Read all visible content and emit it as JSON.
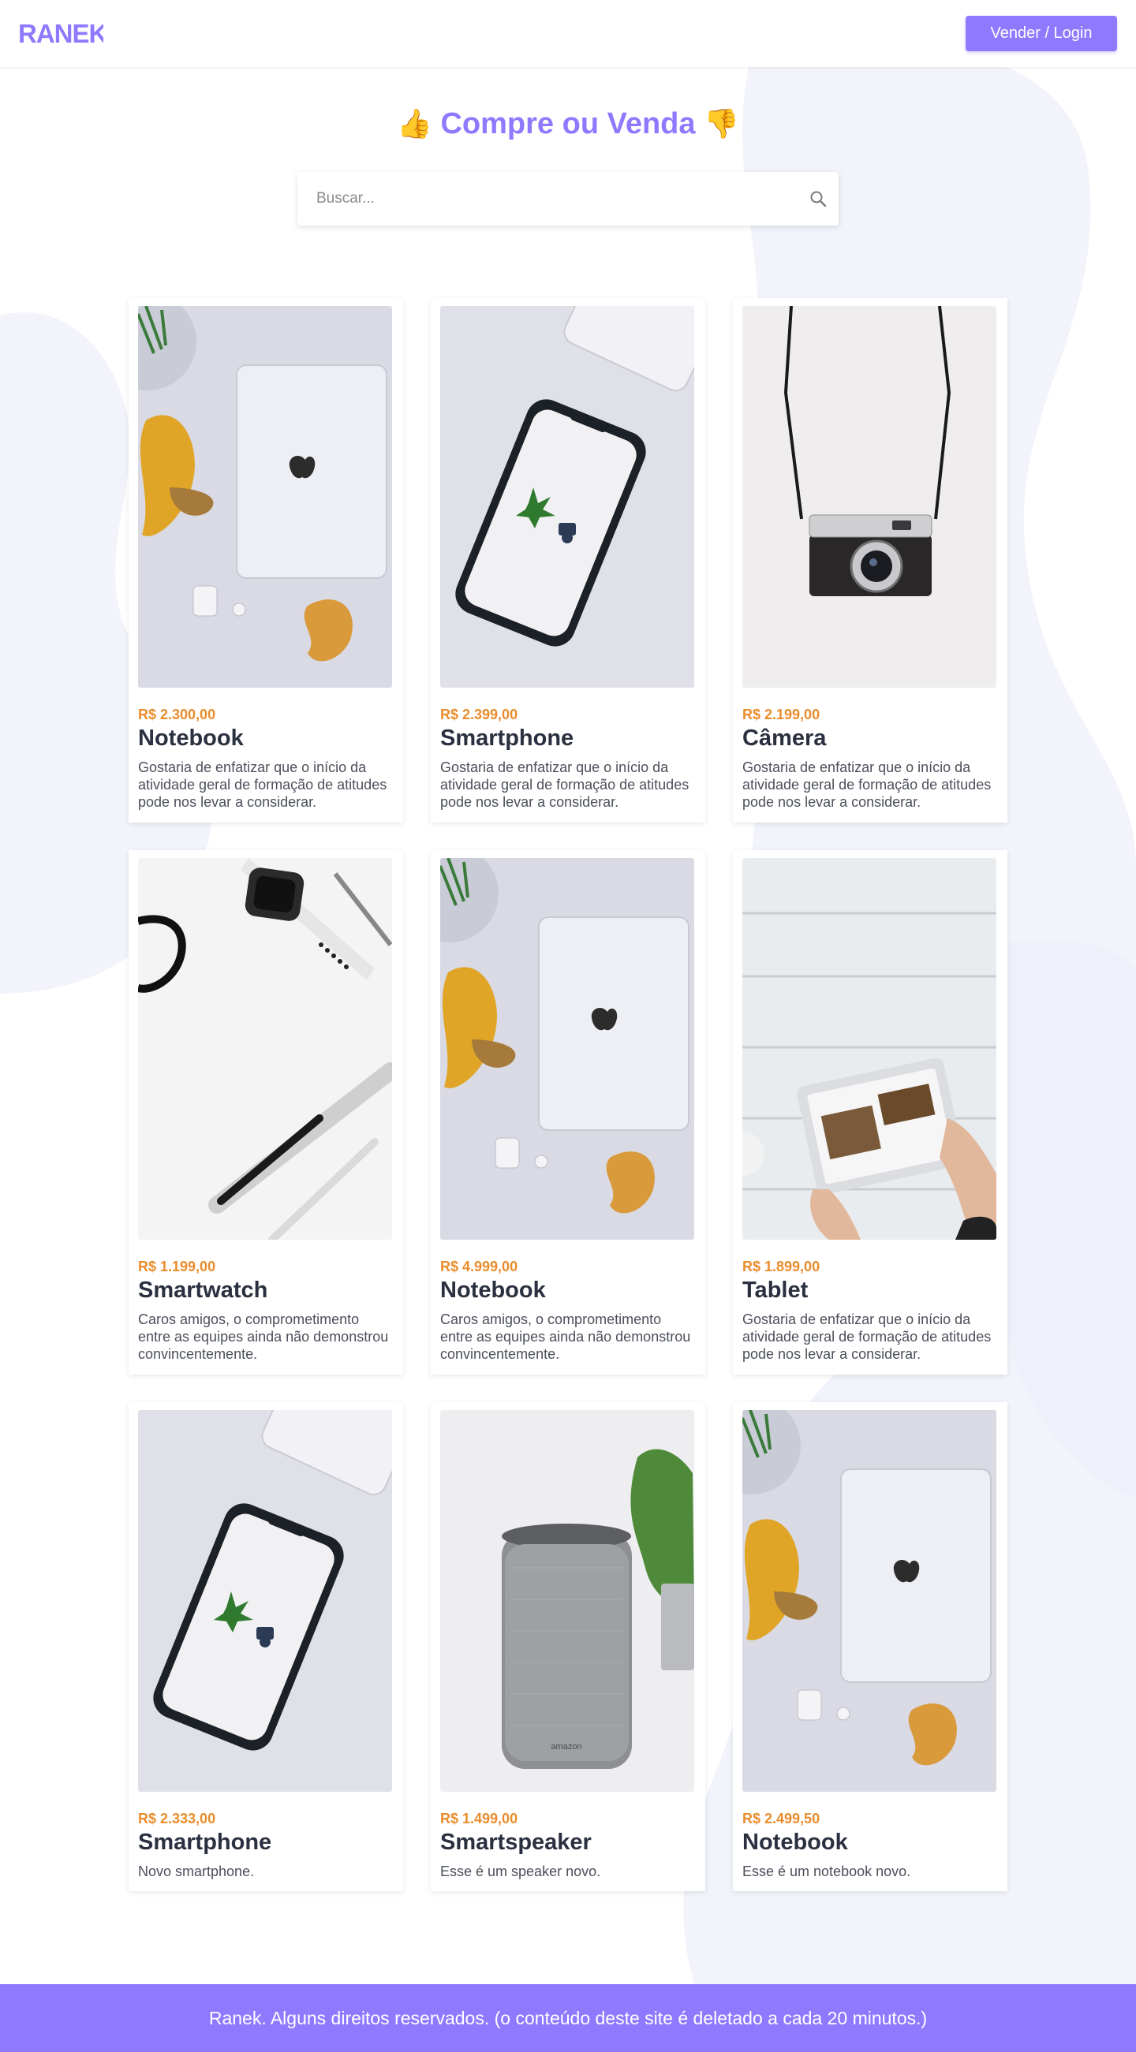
{
  "header": {
    "logo_text": "RANEK",
    "login_label": "Vender / Login"
  },
  "hero": {
    "title": "Compre ou Venda",
    "icon_left": "thumbs-up-icon",
    "icon_right": "thumbs-down-icon",
    "emoji_left": "👍",
    "emoji_right": "👎"
  },
  "search": {
    "placeholder": "Buscar...",
    "value": "",
    "icon": "search-icon"
  },
  "products": [
    {
      "price": "R$ 2.300,00",
      "name": "Notebook",
      "desc": "Gostaria de enfatizar que o início da atividade geral de formação de atitudes pode nos levar a considerar.",
      "image": "notebook-photo"
    },
    {
      "price": "R$ 2.399,00",
      "name": "Smartphone",
      "desc": "Gostaria de enfatizar que o início da atividade geral de formação de atitudes pode nos levar a considerar.",
      "image": "smartphone-photo"
    },
    {
      "price": "R$ 2.199,00",
      "name": "Câmera",
      "desc": "Gostaria de enfatizar que o início da atividade geral de formação de atitudes pode nos levar a considerar.",
      "image": "camera-photo"
    },
    {
      "price": "R$ 1.199,00",
      "name": "Smartwatch",
      "desc": "Caros amigos, o comprometimento entre as equipes ainda não demonstrou convincentemente.",
      "image": "smartwatch-photo"
    },
    {
      "price": "R$ 4.999,00",
      "name": "Notebook",
      "desc": "Caros amigos, o comprometimento entre as equipes ainda não demonstrou convincentemente.",
      "image": "notebook-photo"
    },
    {
      "price": "R$ 1.899,00",
      "name": "Tablet",
      "desc": "Gostaria de enfatizar que o início da atividade geral de formação de atitudes pode nos levar a considerar.",
      "image": "tablet-photo"
    },
    {
      "price": "R$ 2.333,00",
      "name": "Smartphone",
      "desc": "Novo smartphone.",
      "image": "smartphone-photo"
    },
    {
      "price": "R$ 1.499,00",
      "name": "Smartspeaker",
      "desc": "Esse é um speaker novo.",
      "image": "smartspeaker-photo"
    },
    {
      "price": "R$ 2.499,50",
      "name": "Notebook",
      "desc": "Esse é um notebook novo.",
      "image": "notebook-photo"
    }
  ],
  "footer": {
    "text": "Ranek. Alguns direitos reservados. (o conteúdo deste site é deletado a cada 20 minutos.)"
  },
  "colors": {
    "accent": "#8f79ff",
    "price": "#ea8c2b",
    "blob": "#f2f3fb"
  }
}
